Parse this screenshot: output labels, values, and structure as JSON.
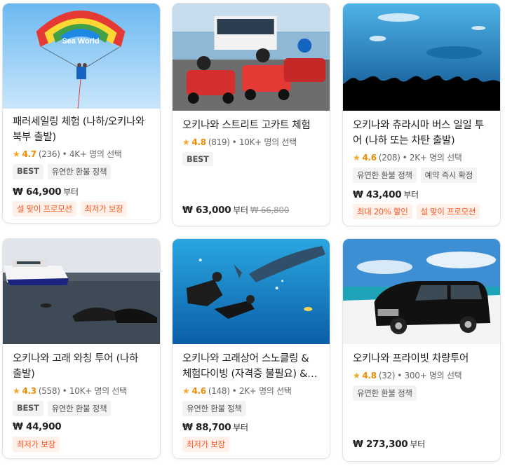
{
  "colors": {
    "accent": "#ff5722",
    "star": "#f5a623",
    "promo_bg": "#fff1ea",
    "tag_bg": "#f3f3f3"
  },
  "cards": [
    {
      "title": "패러세일링 체험 (나하/오키나와 북부 출발)",
      "image_icon": "parasailing-photo",
      "rating": "4.7",
      "reviews": "(236)",
      "booked": "• 4K+ 명의 선택",
      "tags": [
        "BEST",
        "유연한 환불 정책"
      ],
      "price": "₩ 64,900",
      "price_suffix": "부터",
      "orig_price": "",
      "promos": [
        "설 맞이 프로모션",
        "최저가 보장"
      ]
    },
    {
      "title": "오키나와 스트리트 고카트 체험",
      "image_icon": "go-kart-photo",
      "rating": "4.8",
      "reviews": "(819)",
      "booked": "• 10K+ 명의 선택",
      "tags": [
        "BEST"
      ],
      "price": "₩ 63,000",
      "price_suffix": "부터",
      "orig_price": "₩ 66,800",
      "promos": []
    },
    {
      "title": "오키나와 츄라시마 버스 일일 투어 (나하 또는 차탄 출발)",
      "image_icon": "aquarium-photo",
      "rating": "4.6",
      "reviews": "(208)",
      "booked": "• 2K+ 명의 선택",
      "tags": [
        "유연한 환불 정책",
        "예약 즉시 확정"
      ],
      "price": "₩ 43,400",
      "price_suffix": "부터",
      "orig_price": "",
      "promos": [
        "최대 20% 할인",
        "설 맞이 프로모션"
      ]
    },
    {
      "title": "오키나와 고래 와칭 투어 (나하 출발)",
      "image_icon": "whale-watching-photo",
      "rating": "4.3",
      "reviews": "(558)",
      "booked": "• 10K+ 명의 선택",
      "tags": [
        "BEST",
        "유연한 환불 정책"
      ],
      "price": "₩ 44,900",
      "price_suffix": "",
      "orig_price": "",
      "promos": [
        "최저가 보장"
      ]
    },
    {
      "title": "오키나와 고래상어 스노클링 & 체험다이빙 (자격증 불필요) & 편 ...",
      "image_icon": "whale-shark-diving-photo",
      "rating": "4.6",
      "reviews": "(148)",
      "booked": "• 2K+ 명의 선택",
      "tags": [
        "유연한 환불 정책"
      ],
      "price": "₩ 88,700",
      "price_suffix": "부터",
      "orig_price": "",
      "promos": [
        "최저가 보장"
      ]
    },
    {
      "title": "오키나와 프라이빗 차량투어",
      "image_icon": "private-van-photo",
      "rating": "4.8",
      "reviews": "(32)",
      "booked": "• 300+ 명의 선택",
      "tags": [
        "유연한 환불 정책"
      ],
      "price": "₩ 273,300",
      "price_suffix": "부터",
      "orig_price": "",
      "promos": []
    }
  ]
}
